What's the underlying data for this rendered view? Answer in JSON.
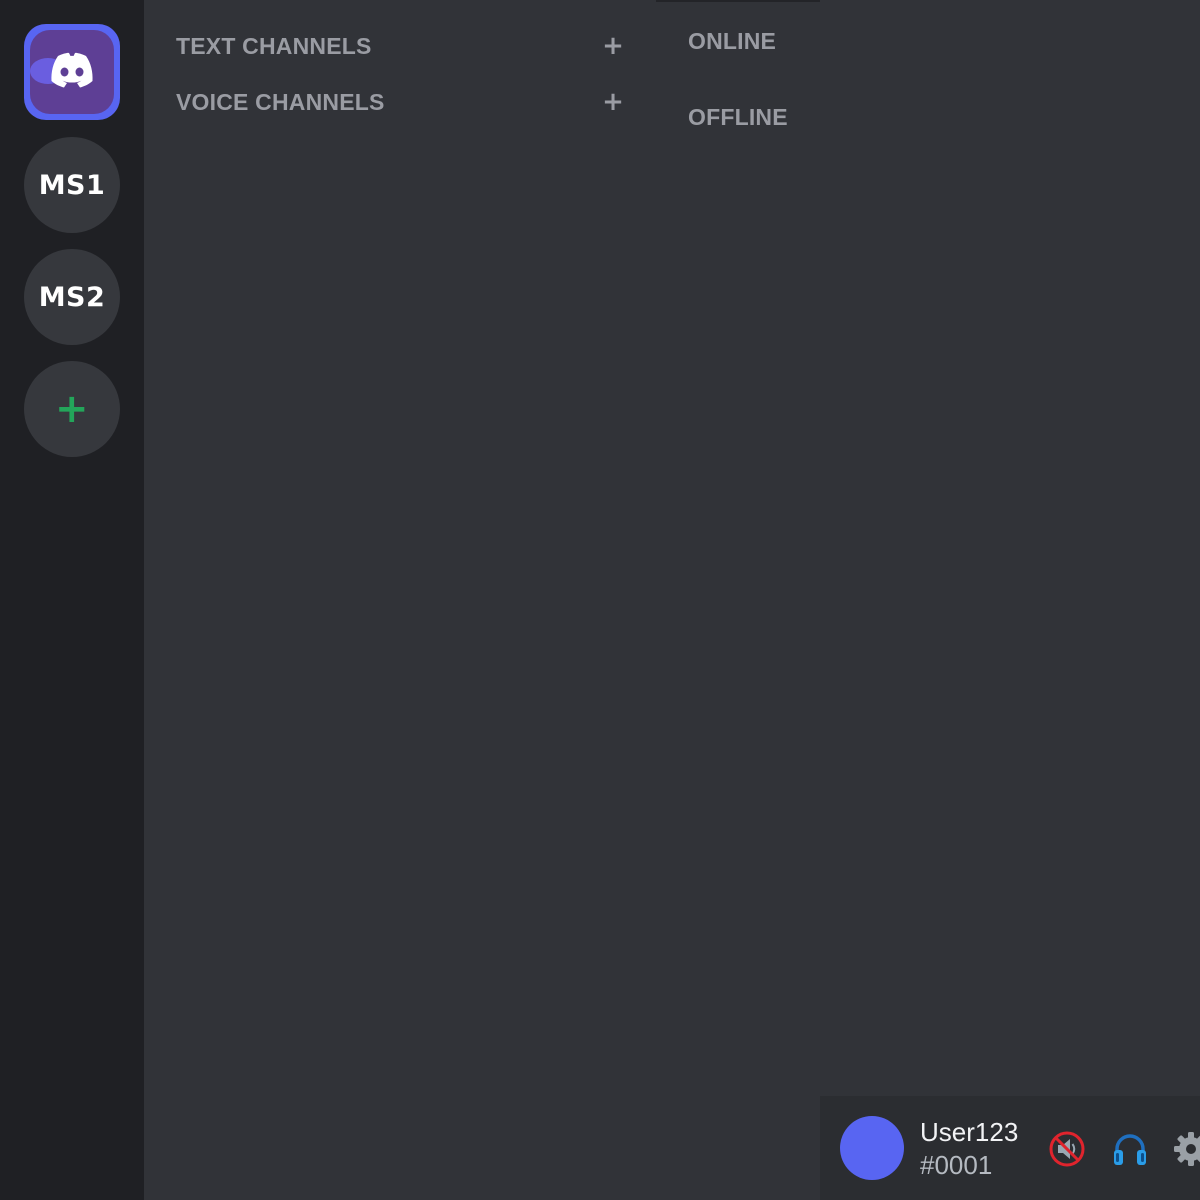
{
  "servers": {
    "home_icon": "discord-logo-icon",
    "items": [
      {
        "label": "MS1"
      },
      {
        "label": "MS2"
      }
    ],
    "add_label": "+"
  },
  "channels": {
    "text_header": "TEXT CHANNELS",
    "voice_header": "VOICE CHANNELS",
    "add_label": "+"
  },
  "members": {
    "online_header": "ONLINE",
    "offline_header": "OFFLINE"
  },
  "user": {
    "name": "User123",
    "discriminator": "#0001",
    "avatar_color": "#5865f2",
    "icons": [
      "muted-speaker-icon",
      "headphones-icon",
      "gear-icon"
    ]
  },
  "colors": {
    "accent": "#5865f2",
    "add_server_green": "#23a55a",
    "background": "#313338",
    "server_rail": "#1f2024"
  }
}
